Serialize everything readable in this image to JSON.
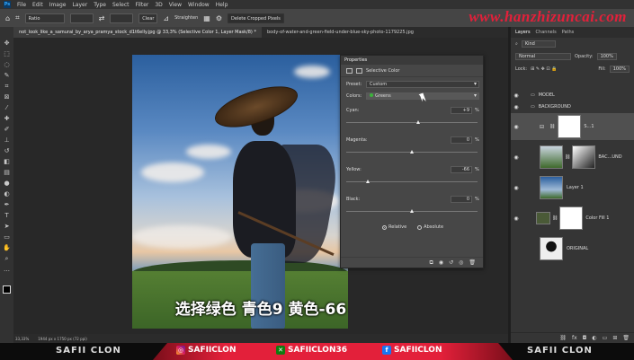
{
  "menu": [
    "File",
    "Edit",
    "Image",
    "Layer",
    "Type",
    "Select",
    "Filter",
    "3D",
    "View",
    "Window",
    "Help"
  ],
  "options": {
    "ratio": "Ratio",
    "clear": "Clear",
    "straighten": "Straighten",
    "delete_cropped": "Delete Cropped Pixels"
  },
  "watermark": "www.hanzhizuncai.com",
  "tabs": [
    {
      "label": "not_look_like_a_samurai_by_arya_pramya_stock_d1t6elly.jpg @ 33,3% (Selective Color 1, Layer Mask/8) *"
    },
    {
      "label": "body-of-water-and-green-field-under-blue-sky-photo-1179225.jpg"
    }
  ],
  "subtitle": "选择绿色 青色9 黄色-66",
  "status": {
    "zoom": "33,33%",
    "size": "1944 px x 1750 px (72 ppi)"
  },
  "properties": {
    "title": "Properties",
    "header": "Selective Color",
    "preset_label": "Preset:",
    "preset_value": "Custom",
    "colors_label": "Colors:",
    "colors_value": "Greens",
    "sliders": [
      {
        "name": "Cyan:",
        "value": "+9",
        "pct": "%",
        "knob": 0.55
      },
      {
        "name": "Magenta:",
        "value": "0",
        "pct": "%",
        "knob": 0.5
      },
      {
        "name": "Yellow:",
        "value": "-66",
        "pct": "%",
        "knob": 0.17
      },
      {
        "name": "Black:",
        "value": "0",
        "pct": "%",
        "knob": 0.5
      }
    ],
    "relative": "Relative",
    "absolute": "Absolute"
  },
  "layers_panel": {
    "tabs": [
      "Layers",
      "Channels",
      "Paths"
    ],
    "kind": "Kind",
    "blend": "Normal",
    "opacity_label": "Opacity:",
    "opacity": "100%",
    "lock_label": "Lock:",
    "fill_label": "Fill:",
    "fill": "100%",
    "layers": [
      {
        "name": "MODEL"
      },
      {
        "name": "BACKGROUND"
      },
      {
        "name": "S...1"
      },
      {
        "name": "BAC...UND"
      },
      {
        "name": "Layer 1"
      },
      {
        "name": "Color Fill 1"
      },
      {
        "name": "ORIGINAL"
      }
    ]
  },
  "footer": {
    "left_name": "SAFII CLON",
    "right_name": "SAFII CLON",
    "instagram": "SAFIICLON",
    "xbox": "SAFIICLON36",
    "facebook": "SAFIICLON"
  }
}
